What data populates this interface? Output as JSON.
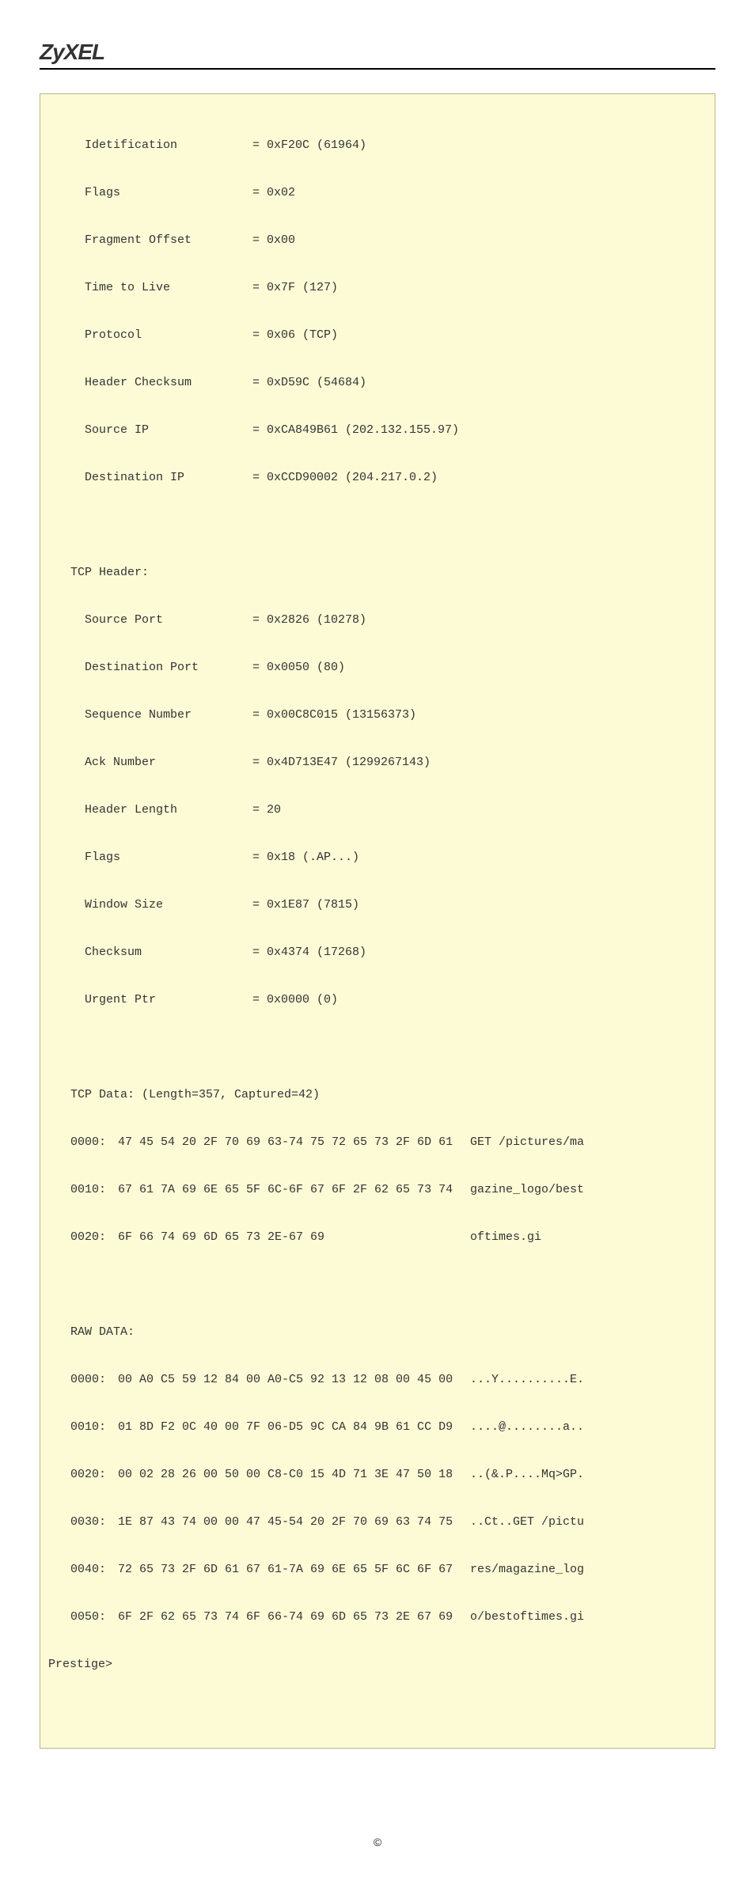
{
  "brand": "ZyXEL",
  "ip_header": {
    "id": {
      "k": "Idetification",
      "v": "= 0xF20C (61964)"
    },
    "flags": {
      "k": "Flags",
      "v": "= 0x02"
    },
    "frag": {
      "k": "Fragment Offset",
      "v": "= 0x00"
    },
    "ttl": {
      "k": "Time to Live",
      "v": "= 0x7F (127)"
    },
    "proto": {
      "k": "Protocol",
      "v": "= 0x06 (TCP)"
    },
    "chk": {
      "k": "Header Checksum",
      "v": "= 0xD59C (54684)"
    },
    "src": {
      "k": "Source IP",
      "v": "= 0xCA849B61 (202.132.155.97)"
    },
    "dst": {
      "k": "Destination IP",
      "v": "= 0xCCD90002 (204.217.0.2)"
    }
  },
  "tcp_title": "TCP Header:",
  "tcp_header": {
    "sport": {
      "k": "Source Port",
      "v": "= 0x2826 (10278)"
    },
    "dport": {
      "k": "Destination Port",
      "v": "= 0x0050 (80)"
    },
    "seq": {
      "k": "Sequence Number",
      "v": "= 0x00C8C015 (13156373)"
    },
    "ack": {
      "k": "Ack Number",
      "v": "= 0x4D713E47 (1299267143)"
    },
    "hlen": {
      "k": "Header Length",
      "v": "= 20"
    },
    "flags": {
      "k": "Flags",
      "v": "= 0x18 (.AP...)"
    },
    "win": {
      "k": "Window Size",
      "v": "= 0x1E87 (7815)"
    },
    "chk": {
      "k": "Checksum",
      "v": "= 0x4374 (17268)"
    },
    "urg": {
      "k": "Urgent Ptr",
      "v": "= 0x0000 (0)"
    }
  },
  "tcp_data_title": "TCP Data: (Length=357, Captured=42)",
  "tcp_data": [
    {
      "off": "0000:",
      "hex": "47 45 54 20 2F 70 69 63-74 75 72 65 73 2F 6D 61",
      "txt": "GET /pictures/ma"
    },
    {
      "off": "0010:",
      "hex": "67 61 7A 69 6E 65 5F 6C-6F 67 6F 2F 62 65 73 74",
      "txt": "gazine_logo/best"
    },
    {
      "off": "0020:",
      "hex": "6F 66 74 69 6D 65 73 2E-67 69",
      "txt": "oftimes.gi"
    }
  ],
  "raw_title": "RAW DATA:",
  "raw_data": [
    {
      "off": "0000:",
      "hex": "00 A0 C5 59 12 84 00 A0-C5 92 13 12 08 00 45 00",
      "txt": "...Y..........E."
    },
    {
      "off": "0010:",
      "hex": "01 8D F2 0C 40 00 7F 06-D5 9C CA 84 9B 61 CC D9",
      "txt": "....@........a.."
    },
    {
      "off": "0020:",
      "hex": "00 02 28 26 00 50 00 C8-C0 15 4D 71 3E 47 50 18",
      "txt": "..(&.P....Mq>GP."
    },
    {
      "off": "0030:",
      "hex": "1E 87 43 74 00 00 47 45-54 20 2F 70 69 63 74 75",
      "txt": "..Ct..GET /pictu"
    },
    {
      "off": "0040:",
      "hex": "72 65 73 2F 6D 61 67 61-7A 69 6E 65 5F 6C 6F 67",
      "txt": "res/magazine_log"
    },
    {
      "off": "0050:",
      "hex": "6F 2F 62 65 73 74 6F 66-74 69 6D 65 73 2E 67 69",
      "txt": "o/bestoftimes.gi"
    }
  ],
  "prompt": "Prestige>",
  "copyright": "©"
}
